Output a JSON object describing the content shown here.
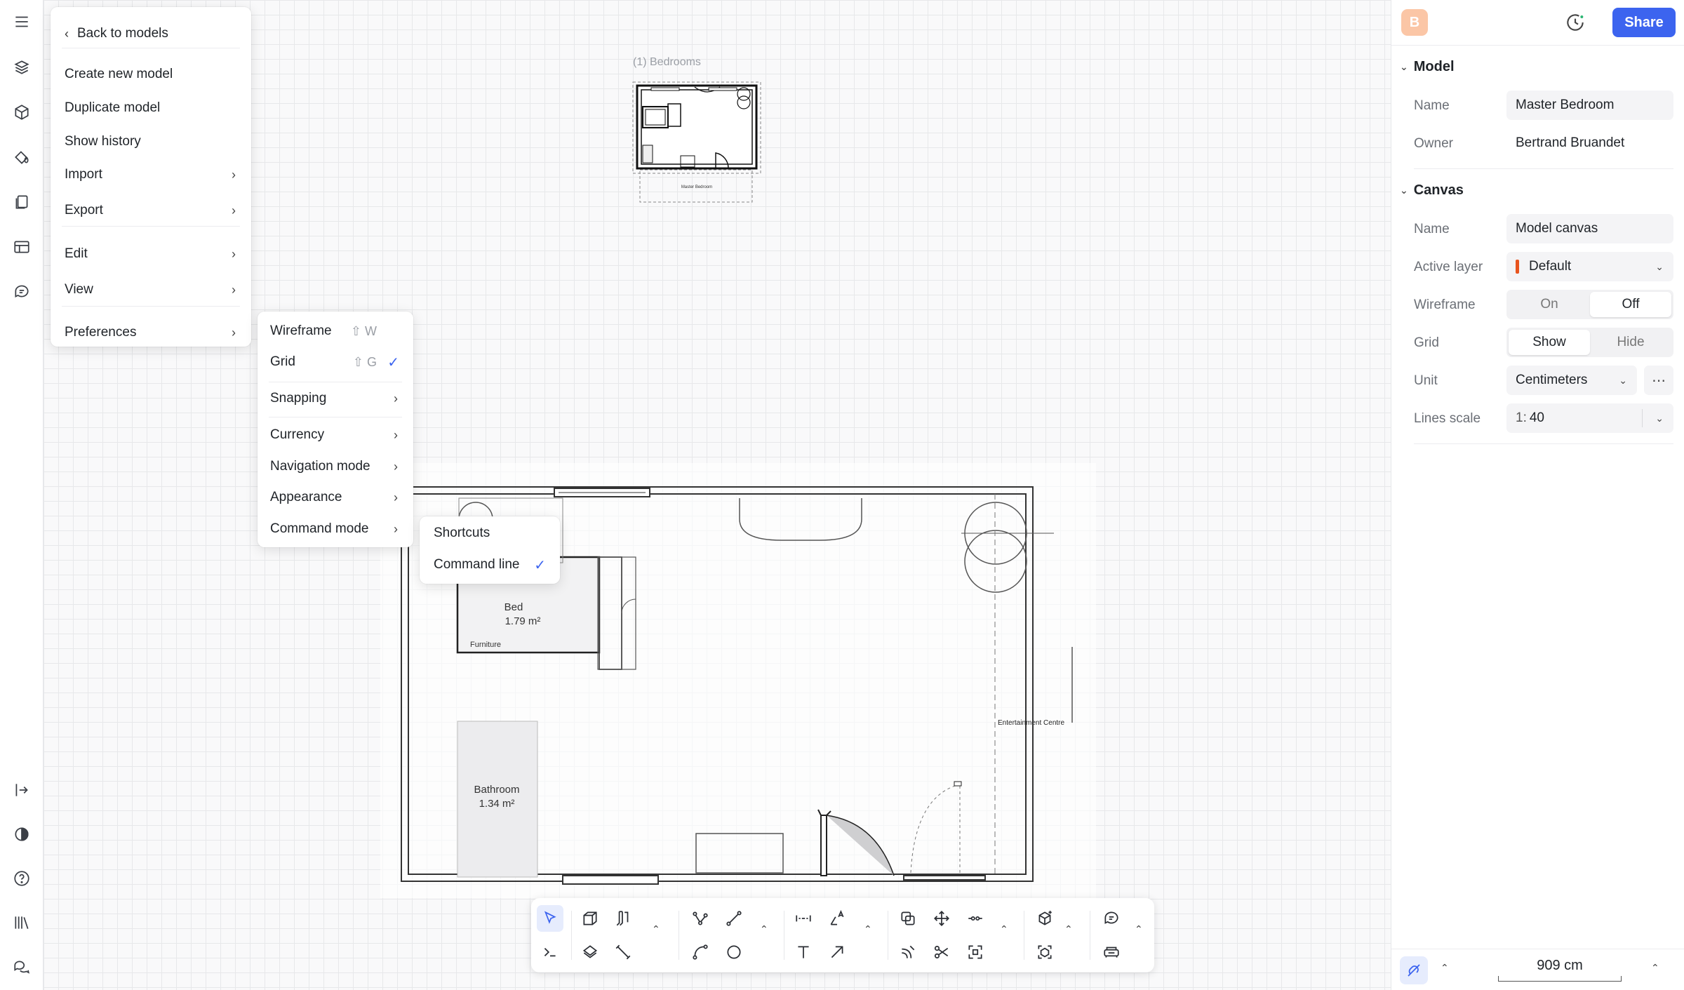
{
  "app": {
    "user_initial": "B",
    "share_label": "Share",
    "accent": "#3c64ef"
  },
  "main_menu": {
    "back_label": "Back to models",
    "items": [
      {
        "label": "Create new model"
      },
      {
        "label": "Duplicate model"
      },
      {
        "label": "Show history"
      },
      {
        "label": "Import"
      },
      {
        "label": "Export"
      },
      {
        "label": "Edit"
      },
      {
        "label": "View"
      },
      {
        "label": "Preferences"
      }
    ]
  },
  "preferences_menu": {
    "items": [
      {
        "label": "Wireframe",
        "shortcut": "⇧ W"
      },
      {
        "label": "Grid",
        "shortcut": "⇧ G",
        "checked": "✓"
      },
      {
        "label": "Snapping"
      },
      {
        "label": "Currency"
      },
      {
        "label": "Navigation mode"
      },
      {
        "label": "Appearance"
      },
      {
        "label": "Command mode"
      }
    ]
  },
  "command_mode_menu": {
    "items": [
      {
        "label": "Shortcuts"
      },
      {
        "label": "Command line",
        "checked": "✓"
      }
    ]
  },
  "canvas": {
    "view_label": "(1) Bedrooms",
    "thumb_room_label": "Master Bedroom",
    "rooms": [
      {
        "name": "Bed",
        "area": "1.79 m²",
        "tag": "Furniture"
      },
      {
        "name": "Bathroom",
        "area": "1.34 m²"
      }
    ],
    "entertainment_label": "Entertainment Centre"
  },
  "panel": {
    "model_section": "Model",
    "model_name_label": "Name",
    "model_name": "Master Bedroom",
    "owner_label": "Owner",
    "owner": "Bertrand Bruandet",
    "canvas_section": "Canvas",
    "canvas_name_label": "Name",
    "canvas_name": "Model canvas",
    "active_layer_label": "Active layer",
    "active_layer": "Default",
    "layer_color": "#e8541e",
    "wireframe_label": "Wireframe",
    "wireframe_on": "On",
    "wireframe_off": "Off",
    "grid_label": "Grid",
    "grid_show": "Show",
    "grid_hide": "Hide",
    "unit_label": "Unit",
    "unit": "Centimeters",
    "lines_scale_label": "Lines scale",
    "lines_scale_prefix": "1:",
    "lines_scale": "40",
    "ruler_value": "909 cm"
  }
}
